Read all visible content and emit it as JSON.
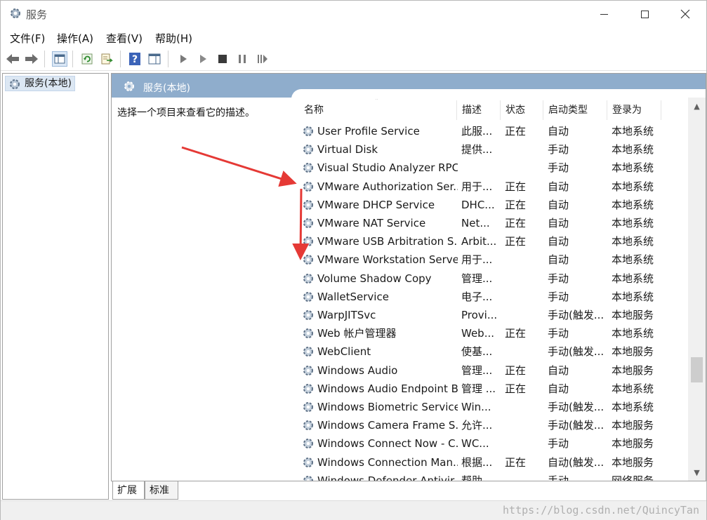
{
  "window": {
    "title": "服务"
  },
  "menu": [
    {
      "label": "文件(F)"
    },
    {
      "label": "操作(A)"
    },
    {
      "label": "查看(V)"
    },
    {
      "label": "帮助(H)"
    }
  ],
  "tree": {
    "item": "服务(本地)"
  },
  "pane": {
    "title": "服务(本地)",
    "description": "选择一个项目来查看它的描述。"
  },
  "columns": [
    "名称",
    "描述",
    "状态",
    "启动类型",
    "登录为"
  ],
  "services": [
    {
      "name": "User Profile Service",
      "desc": "此服...",
      "status": "正在",
      "start": "自动",
      "logon": "本地系统"
    },
    {
      "name": "Virtual Disk",
      "desc": "提供...",
      "status": "",
      "start": "手动",
      "logon": "本地系统"
    },
    {
      "name": "Visual Studio Analyzer RPC...",
      "desc": "",
      "status": "",
      "start": "手动",
      "logon": "本地系统"
    },
    {
      "name": "VMware Authorization Ser...",
      "desc": "用于...",
      "status": "正在",
      "start": "自动",
      "logon": "本地系统"
    },
    {
      "name": "VMware DHCP Service",
      "desc": "DHC...",
      "status": "正在",
      "start": "自动",
      "logon": "本地系统"
    },
    {
      "name": "VMware NAT Service",
      "desc": "Net...",
      "status": "正在",
      "start": "自动",
      "logon": "本地系统"
    },
    {
      "name": "VMware USB Arbitration S...",
      "desc": "Arbit...",
      "status": "正在",
      "start": "自动",
      "logon": "本地系统"
    },
    {
      "name": "VMware Workstation Server",
      "desc": "用于...",
      "status": "",
      "start": "自动",
      "logon": "本地系统"
    },
    {
      "name": "Volume Shadow Copy",
      "desc": "管理...",
      "status": "",
      "start": "手动",
      "logon": "本地系统"
    },
    {
      "name": "WalletService",
      "desc": "电子...",
      "status": "",
      "start": "手动",
      "logon": "本地系统"
    },
    {
      "name": "WarpJITSvc",
      "desc": "Provi...",
      "status": "",
      "start": "手动(触发...",
      "logon": "本地服务"
    },
    {
      "name": "Web 帐户管理器",
      "desc": "Web...",
      "status": "正在",
      "start": "手动",
      "logon": "本地系统"
    },
    {
      "name": "WebClient",
      "desc": "使基...",
      "status": "",
      "start": "手动(触发...",
      "logon": "本地服务"
    },
    {
      "name": "Windows Audio",
      "desc": "管理...",
      "status": "正在",
      "start": "自动",
      "logon": "本地服务"
    },
    {
      "name": "Windows Audio Endpoint B...",
      "desc": "管理 ...",
      "status": "正在",
      "start": "自动",
      "logon": "本地系统"
    },
    {
      "name": "Windows Biometric Service",
      "desc": "Win...",
      "status": "",
      "start": "手动(触发...",
      "logon": "本地系统"
    },
    {
      "name": "Windows Camera Frame S...",
      "desc": "允许...",
      "status": "",
      "start": "手动(触发...",
      "logon": "本地服务"
    },
    {
      "name": "Windows Connect Now - C...",
      "desc": "WC...",
      "status": "",
      "start": "手动",
      "logon": "本地服务"
    },
    {
      "name": "Windows Connection Man...",
      "desc": "根据...",
      "status": "正在",
      "start": "自动(触发...",
      "logon": "本地服务"
    },
    {
      "name": "Windows Defender Antivir...",
      "desc": "帮助...",
      "status": "",
      "start": "手动",
      "logon": "网络服务"
    }
  ],
  "tabs": [
    "扩展",
    "标准"
  ],
  "watermark": "https://blog.csdn.net/QuincyTan",
  "colors": {
    "header": "#8fadcc",
    "arrow": "#e53935",
    "selected": "#dce7f3"
  }
}
